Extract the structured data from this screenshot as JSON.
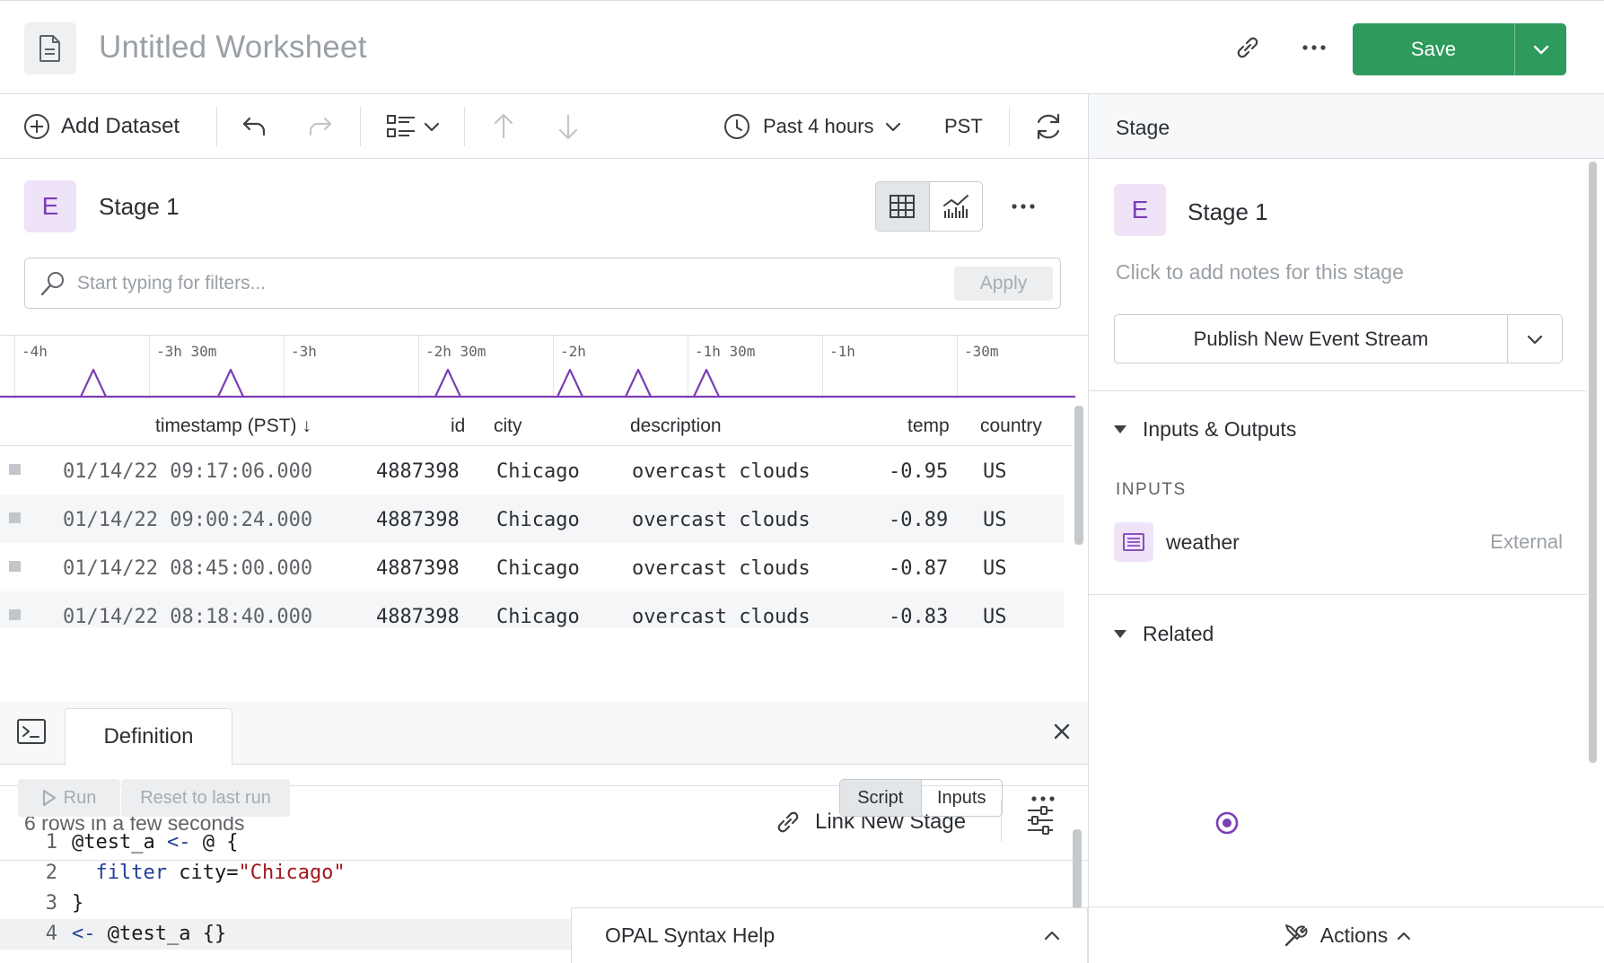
{
  "header": {
    "title": "Untitled Worksheet",
    "save_label": "Save"
  },
  "toolbar": {
    "add_dataset_label": "Add Dataset",
    "time_range": "Past 4 hours",
    "timezone": "PST"
  },
  "stage": {
    "badge": "E",
    "name": "Stage 1",
    "filter_placeholder": "Start typing for filters...",
    "apply_label": "Apply"
  },
  "histogram": {
    "labels": [
      "-4h",
      "-3h 30m",
      "-3h",
      "-2h 30m",
      "-2h",
      "-1h 30m",
      "-1h",
      "-30m"
    ],
    "accent": "#7a3fb5"
  },
  "table": {
    "columns": {
      "timestamp": "timestamp (PST) ↓",
      "id": "id",
      "city": "city",
      "description": "description",
      "temp": "temp",
      "country": "country"
    },
    "rows": [
      {
        "timestamp": "01/14/22 09:17:06.000",
        "id": "4887398",
        "city": "Chicago",
        "description": "overcast clouds",
        "temp": "-0.95",
        "country": "US"
      },
      {
        "timestamp": "01/14/22 09:00:24.000",
        "id": "4887398",
        "city": "Chicago",
        "description": "overcast clouds",
        "temp": "-0.89",
        "country": "US"
      },
      {
        "timestamp": "01/14/22 08:45:00.000",
        "id": "4887398",
        "city": "Chicago",
        "description": "overcast clouds",
        "temp": "-0.87",
        "country": "US"
      },
      {
        "timestamp": "01/14/22 08:18:40.000",
        "id": "4887398",
        "city": "Chicago",
        "description": "overcast clouds",
        "temp": "-0.83",
        "country": "US"
      }
    ]
  },
  "stage_footer": {
    "rows_info": "6 rows in a few seconds",
    "link_new_stage": "Link New Stage"
  },
  "definition": {
    "tab_label": "Definition",
    "run_label": "Run",
    "reset_label": "Reset to last run",
    "mode_script": "Script",
    "mode_inputs": "Inputs",
    "code_lines": [
      {
        "num": "1"
      },
      {
        "num": "2"
      },
      {
        "num": "3"
      },
      {
        "num": "4"
      }
    ],
    "code": {
      "l1_name": "@test_a",
      "l1_op": "<-",
      "l1_rest": "@ {",
      "l2_kw": "filter",
      "l2_expr": "city=",
      "l2_str": "\"Chicago\"",
      "l3": "}",
      "l4_op": "<-",
      "l4_rest": "@test_a {}"
    },
    "opal_help_label": "OPAL Syntax Help"
  },
  "right_panel": {
    "header_title": "Stage",
    "stage_badge": "E",
    "stage_name": "Stage 1",
    "notes_placeholder": "Click to add notes for this stage",
    "publish_label": "Publish New Event Stream",
    "inputs_outputs_label": "Inputs & Outputs",
    "inputs_label": "INPUTS",
    "input_name": "weather",
    "input_type": "External",
    "related_label": "Related",
    "actions_label": "Actions"
  },
  "colors": {
    "primary_green": "#2e9a5c",
    "stage_purple": "#7a3fb5",
    "badge_bg": "#efe3f8"
  }
}
